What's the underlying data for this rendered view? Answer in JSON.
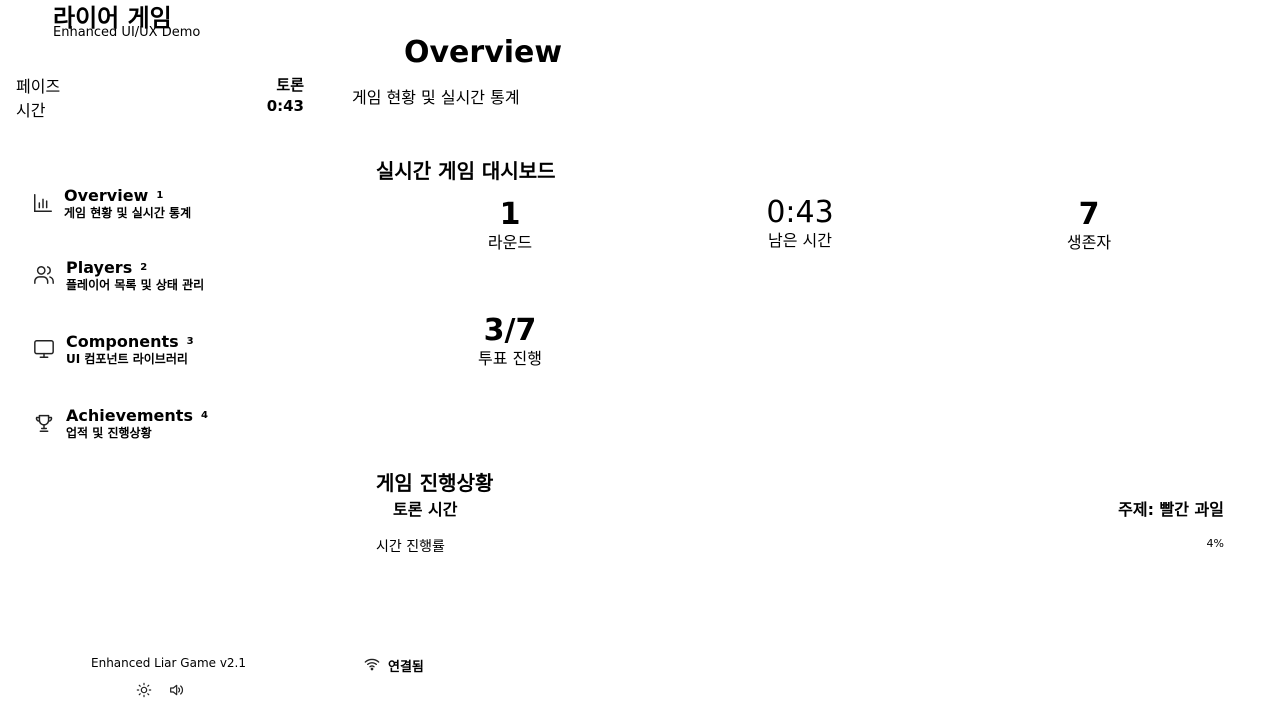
{
  "sidebar": {
    "app_title": "라이어 게임",
    "app_subtitle": "Enhanced UI/UX Demo",
    "info": [
      {
        "label": "페이즈",
        "value": "토론"
      },
      {
        "label": "시간",
        "value": "0:43"
      }
    ],
    "nav": [
      {
        "label": "Overview",
        "badge": "1",
        "description": "게임 현황 및 실시간 통계",
        "icon": "bar-chart-icon"
      },
      {
        "label": "Players",
        "badge": "2",
        "description": "플레이어 목록 및 상태 관리",
        "icon": "users-icon"
      },
      {
        "label": "Components",
        "badge": "3",
        "description": "UI 컴포넌트 라이브러리",
        "icon": "monitor-icon"
      },
      {
        "label": "Achievements",
        "badge": "4",
        "description": "업적 및 진행상황",
        "icon": "trophy-icon"
      }
    ],
    "footer": {
      "version": "Enhanced Liar Game v2.1",
      "buttons": [
        "sun-icon",
        "volume-icon"
      ]
    }
  },
  "main": {
    "title": "Overview",
    "subtitle": "게임 현황 및 실시간 통계",
    "dashboard": {
      "title": "실시간 게임 대시보드",
      "stats": [
        {
          "value": "1",
          "label": "라운드"
        },
        {
          "value": "0:43",
          "label": "남은 시간"
        },
        {
          "value": "7",
          "label": "생존자"
        },
        {
          "value": "3/7",
          "label": "투표 진행"
        }
      ]
    },
    "progress": {
      "title": "게임 진행상황",
      "phase": "토론 시간",
      "topic": "주제: 빨간 과일",
      "bar_label": "시간 진행률",
      "percent_text": "4%",
      "percent_value": 4
    },
    "connection": {
      "label": "연결됨",
      "icon": "wifi-icon"
    }
  }
}
